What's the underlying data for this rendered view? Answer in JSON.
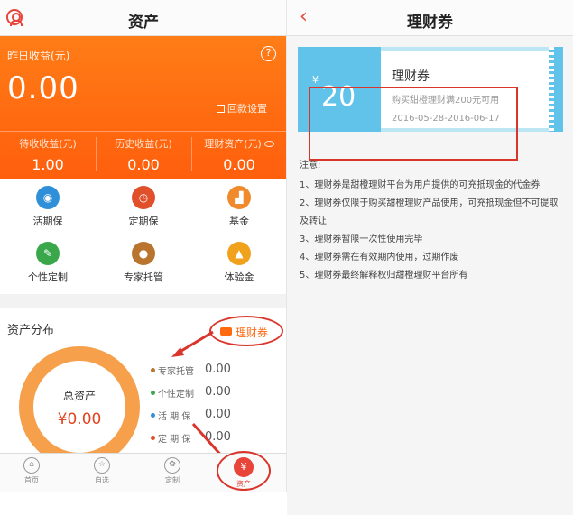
{
  "left": {
    "header_title": "资产",
    "hero": {
      "yesterday_label": "昨日收益(元)",
      "yesterday_value": "0.00",
      "help": "?",
      "payback_setting": "回款设置",
      "stats": [
        {
          "label": "待收收益(元)",
          "value": "1.00"
        },
        {
          "label": "历史收益(元)",
          "value": "0.00"
        },
        {
          "label": "理财资产(元)",
          "value": "0.00"
        }
      ]
    },
    "products": [
      {
        "label": "活期保",
        "icon": "piggy-icon",
        "color": "#2f8fd8"
      },
      {
        "label": "定期保",
        "icon": "clock-icon",
        "color": "#e0502b"
      },
      {
        "label": "基金",
        "icon": "chart-icon",
        "color": "#f08a2c"
      },
      {
        "label": "个性定制",
        "icon": "pencil-icon",
        "color": "#3aa84a"
      },
      {
        "label": "专家托管",
        "icon": "expert-icon",
        "color": "#b9742e"
      },
      {
        "label": "体验金",
        "icon": "gold-icon",
        "color": "#f0a21c"
      }
    ],
    "distribution": {
      "title": "资产分布",
      "ticket_link": "理财券",
      "total_label": "总资产",
      "total_value": "¥0.00",
      "legend": [
        {
          "label": "专家托管",
          "value": "0.00",
          "color": "#b9742e"
        },
        {
          "label": "个性定制",
          "value": "0.00",
          "color": "#3aa84a"
        },
        {
          "label": "活 期 保",
          "value": "0.00",
          "color": "#2f8fd8"
        },
        {
          "label": "定 期 保",
          "value": "0.00",
          "color": "#e0502b"
        }
      ]
    },
    "tabs": [
      {
        "label": "首页",
        "icon": "home-icon"
      },
      {
        "label": "自选",
        "icon": "star-icon"
      },
      {
        "label": "定制",
        "icon": "custom-icon"
      },
      {
        "label": "资产",
        "icon": "yen-icon"
      }
    ]
  },
  "right": {
    "header_title": "理财券",
    "back": "‹",
    "coupon": {
      "currency": "¥",
      "amount": "20",
      "name": "理财券",
      "description": "购买甜橙理财满200元可用",
      "date_range": "2016-05-28-2016-06-17"
    },
    "notes": {
      "title": "注意:",
      "items": [
        "1、理财券是甜橙理财平台为用户提供的可充抵现金的代金券",
        "2、理财券仅限于购买甜橙理财产品使用，可充抵现金但不可提取及转让",
        "3、理财券暂限一次性使用完毕",
        "4、理财券需在有效期内使用，过期作废",
        "5、理财券最终解释权归甜橙理财平台所有"
      ]
    }
  },
  "accent": "#ff6a10",
  "annotation_color": "#d9352b"
}
